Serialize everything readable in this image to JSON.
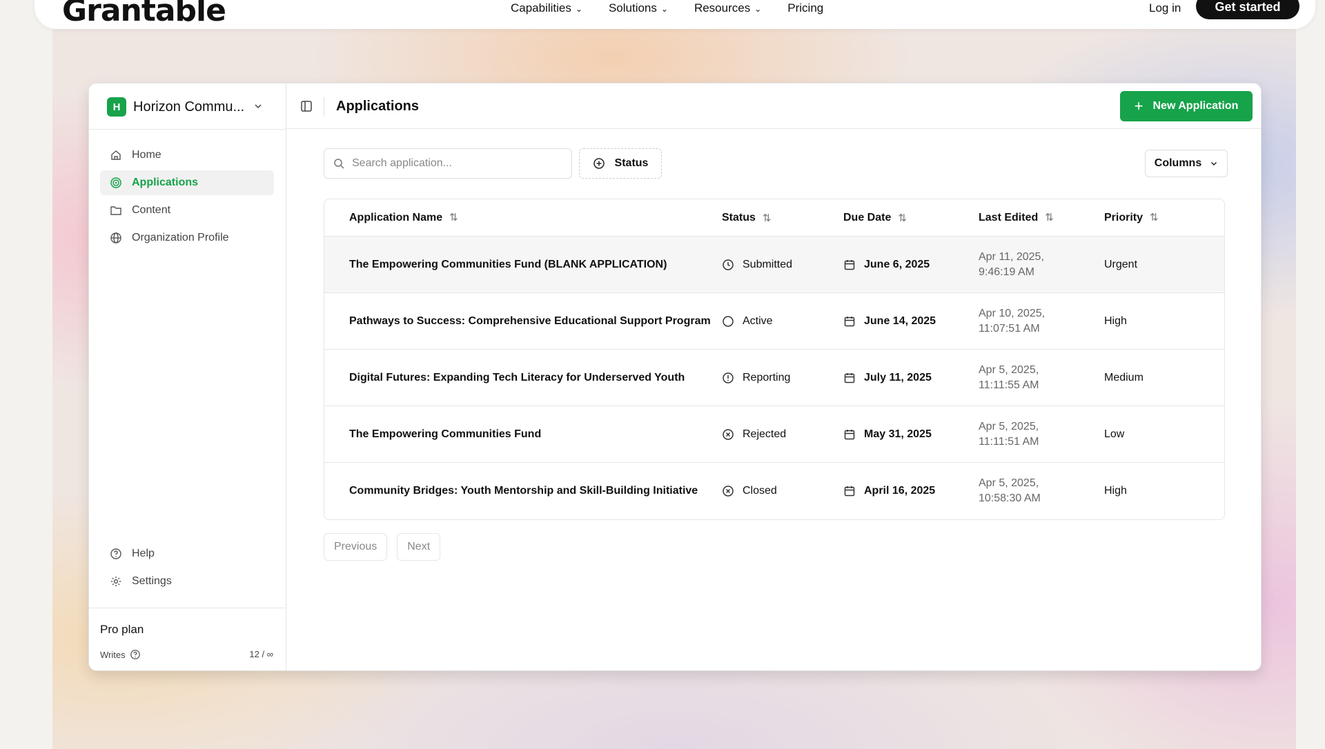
{
  "site": {
    "brand": "Grantable",
    "nav": [
      {
        "label": "Capabilities",
        "has_menu": true
      },
      {
        "label": "Solutions",
        "has_menu": true
      },
      {
        "label": "Resources",
        "has_menu": true
      },
      {
        "label": "Pricing",
        "has_menu": false
      }
    ],
    "login": "Log in",
    "cta": "Get started"
  },
  "sidebar": {
    "org_initial": "H",
    "org_name": "Horizon Commu...",
    "items": [
      {
        "label": "Home",
        "icon": "home-icon",
        "active": false
      },
      {
        "label": "Applications",
        "icon": "target-icon",
        "active": true
      },
      {
        "label": "Content",
        "icon": "folder-icon",
        "active": false
      },
      {
        "label": "Organization Profile",
        "icon": "globe-icon",
        "active": false
      }
    ],
    "bottom_items": [
      {
        "label": "Help",
        "icon": "help-icon"
      },
      {
        "label": "Settings",
        "icon": "gear-icon"
      }
    ],
    "plan": {
      "title": "Pro plan",
      "writes_label": "Writes",
      "writes_count": "12 / ∞"
    }
  },
  "header": {
    "title": "Applications",
    "new_button": "New Application"
  },
  "toolbar": {
    "search_placeholder": "Search application...",
    "status_filter": "Status",
    "columns": "Columns"
  },
  "table": {
    "columns": [
      "Application Name",
      "Status",
      "Due Date",
      "Last Edited",
      "Priority"
    ],
    "rows": [
      {
        "name": "The Empowering Communities Fund (BLANK APPLICATION)",
        "status": "Submitted",
        "status_icon": "clock-icon",
        "due": "June 6, 2025",
        "edited_1": "Apr 11, 2025,",
        "edited_2": "9:46:19 AM",
        "priority": "Urgent"
      },
      {
        "name": "Pathways to Success: Comprehensive Educational Support Program",
        "status": "Active",
        "status_icon": "circle-icon",
        "due": "June 14, 2025",
        "edited_1": "Apr 10, 2025,",
        "edited_2": "11:07:51 AM",
        "priority": "High"
      },
      {
        "name": "Digital Futures: Expanding Tech Literacy for Underserved Youth",
        "status": "Reporting",
        "status_icon": "info-icon",
        "due": "July 11, 2025",
        "edited_1": "Apr 5, 2025,",
        "edited_2": "11:11:55 AM",
        "priority": "Medium"
      },
      {
        "name": "The Empowering Communities Fund",
        "status": "Rejected",
        "status_icon": "x-circle-icon",
        "due": "May 31, 2025",
        "edited_1": "Apr 5, 2025,",
        "edited_2": "11:11:51 AM",
        "priority": "Low"
      },
      {
        "name": "Community Bridges: Youth Mentorship and Skill-Building Initiative",
        "status": "Closed",
        "status_icon": "x-circle-icon",
        "due": "April 16, 2025",
        "edited_1": "Apr 5, 2025,",
        "edited_2": "10:58:30 AM",
        "priority": "High"
      }
    ]
  },
  "pager": {
    "previous": "Previous",
    "next": "Next"
  },
  "colors": {
    "accent": "#16a34a"
  }
}
